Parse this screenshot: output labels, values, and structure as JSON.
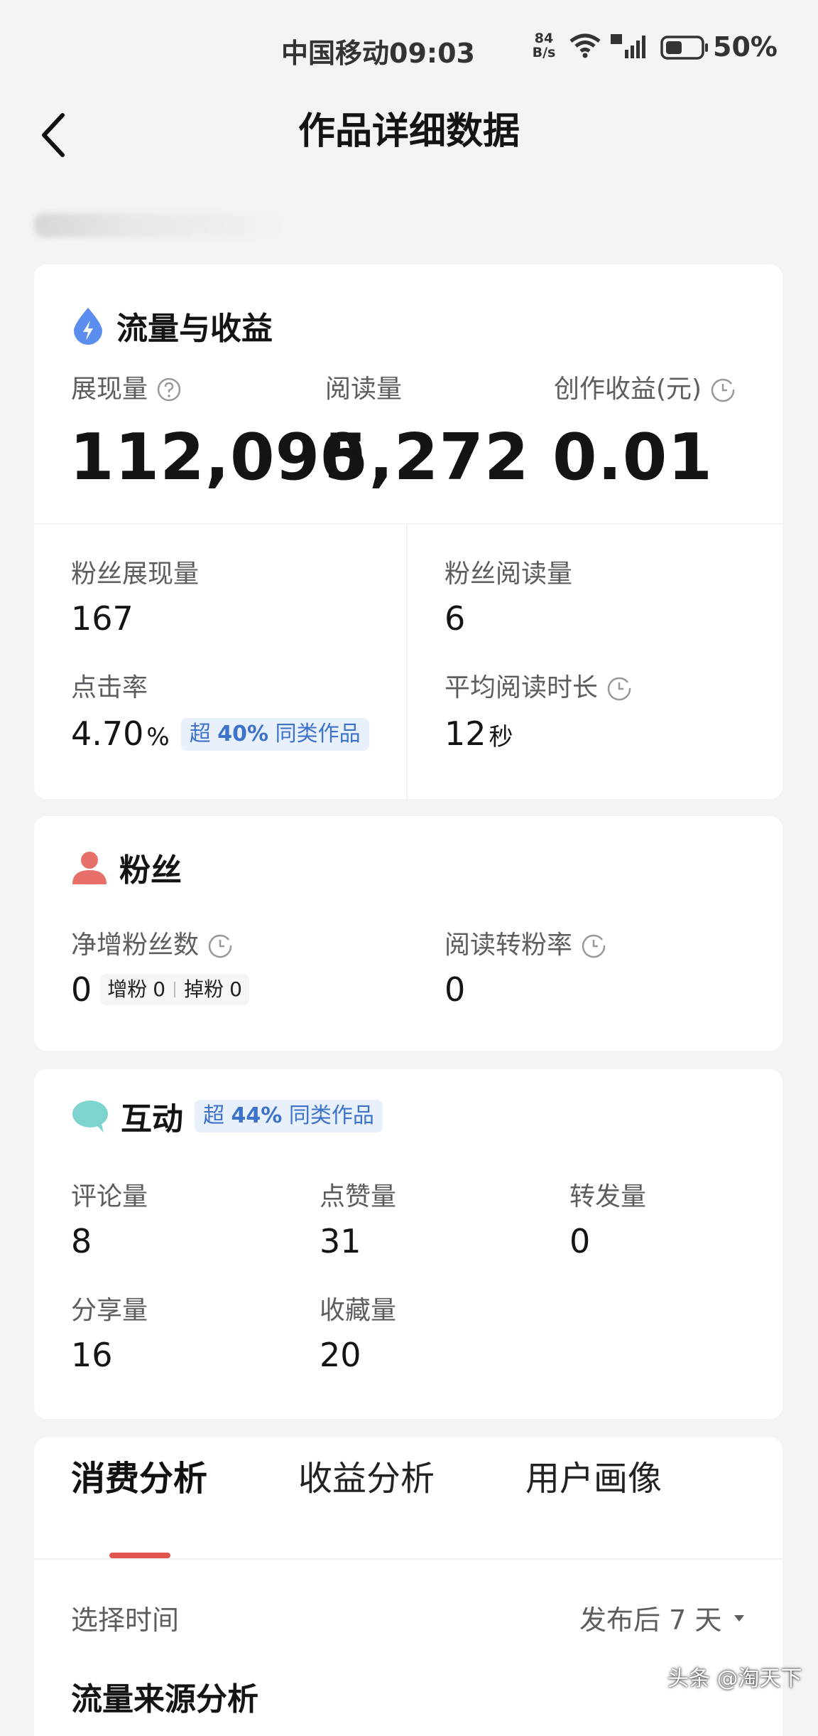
{
  "status_bar": {
    "carrier_time": "中国移动09:03",
    "net_speed_value": "84",
    "net_speed_unit": "B/s",
    "battery": "50%"
  },
  "nav": {
    "title": "作品详细数据"
  },
  "traffic": {
    "title": "流量与收益",
    "impressions_label": "展现量",
    "impressions_value": "112,090",
    "reads_label": "阅读量",
    "reads_value": "5,272",
    "earnings_label": "创作收益(元)",
    "earnings_value": "0.01",
    "fan_impressions_label": "粉丝展现量",
    "fan_impressions_value": "167",
    "fan_reads_label": "粉丝阅读量",
    "fan_reads_value": "6",
    "ctr_label": "点击率",
    "ctr_value": "4.70",
    "ctr_unit": "%",
    "ctr_badge_prefix": "超",
    "ctr_badge_pct": "40%",
    "ctr_badge_suffix": "同类作品",
    "avg_read_label": "平均阅读时长",
    "avg_read_value": "12",
    "avg_read_unit": "秒"
  },
  "fans": {
    "title": "粉丝",
    "net_gain_label": "净增粉丝数",
    "net_gain_value": "0",
    "gain_label": "增粉",
    "gain_value": "0",
    "loss_label": "掉粉",
    "loss_value": "0",
    "conversion_label": "阅读转粉率",
    "conversion_value": "0"
  },
  "interaction": {
    "title": "互动",
    "badge_prefix": "超",
    "badge_pct": "44%",
    "badge_suffix": "同类作品",
    "comments_label": "评论量",
    "comments_value": "8",
    "likes_label": "点赞量",
    "likes_value": "31",
    "reposts_label": "转发量",
    "reposts_value": "0",
    "shares_label": "分享量",
    "shares_value": "16",
    "favorites_label": "收藏量",
    "favorites_value": "20"
  },
  "analysis": {
    "tabs": [
      {
        "label": "消费分析"
      },
      {
        "label": "收益分析"
      },
      {
        "label": "用户画像"
      }
    ],
    "time_label": "选择时间",
    "time_value": "发布后 7 天",
    "section_heading": "流量来源分析"
  },
  "watermark": "头条 @淘天下",
  "colors": {
    "accent_red": "#e0554e",
    "badge_blue": "#3c72c9",
    "badge_bg": "#e8f0fb",
    "fans_icon": "#e8706a",
    "interaction_icon": "#7dd3d0",
    "traffic_icon": "#5b8def"
  }
}
